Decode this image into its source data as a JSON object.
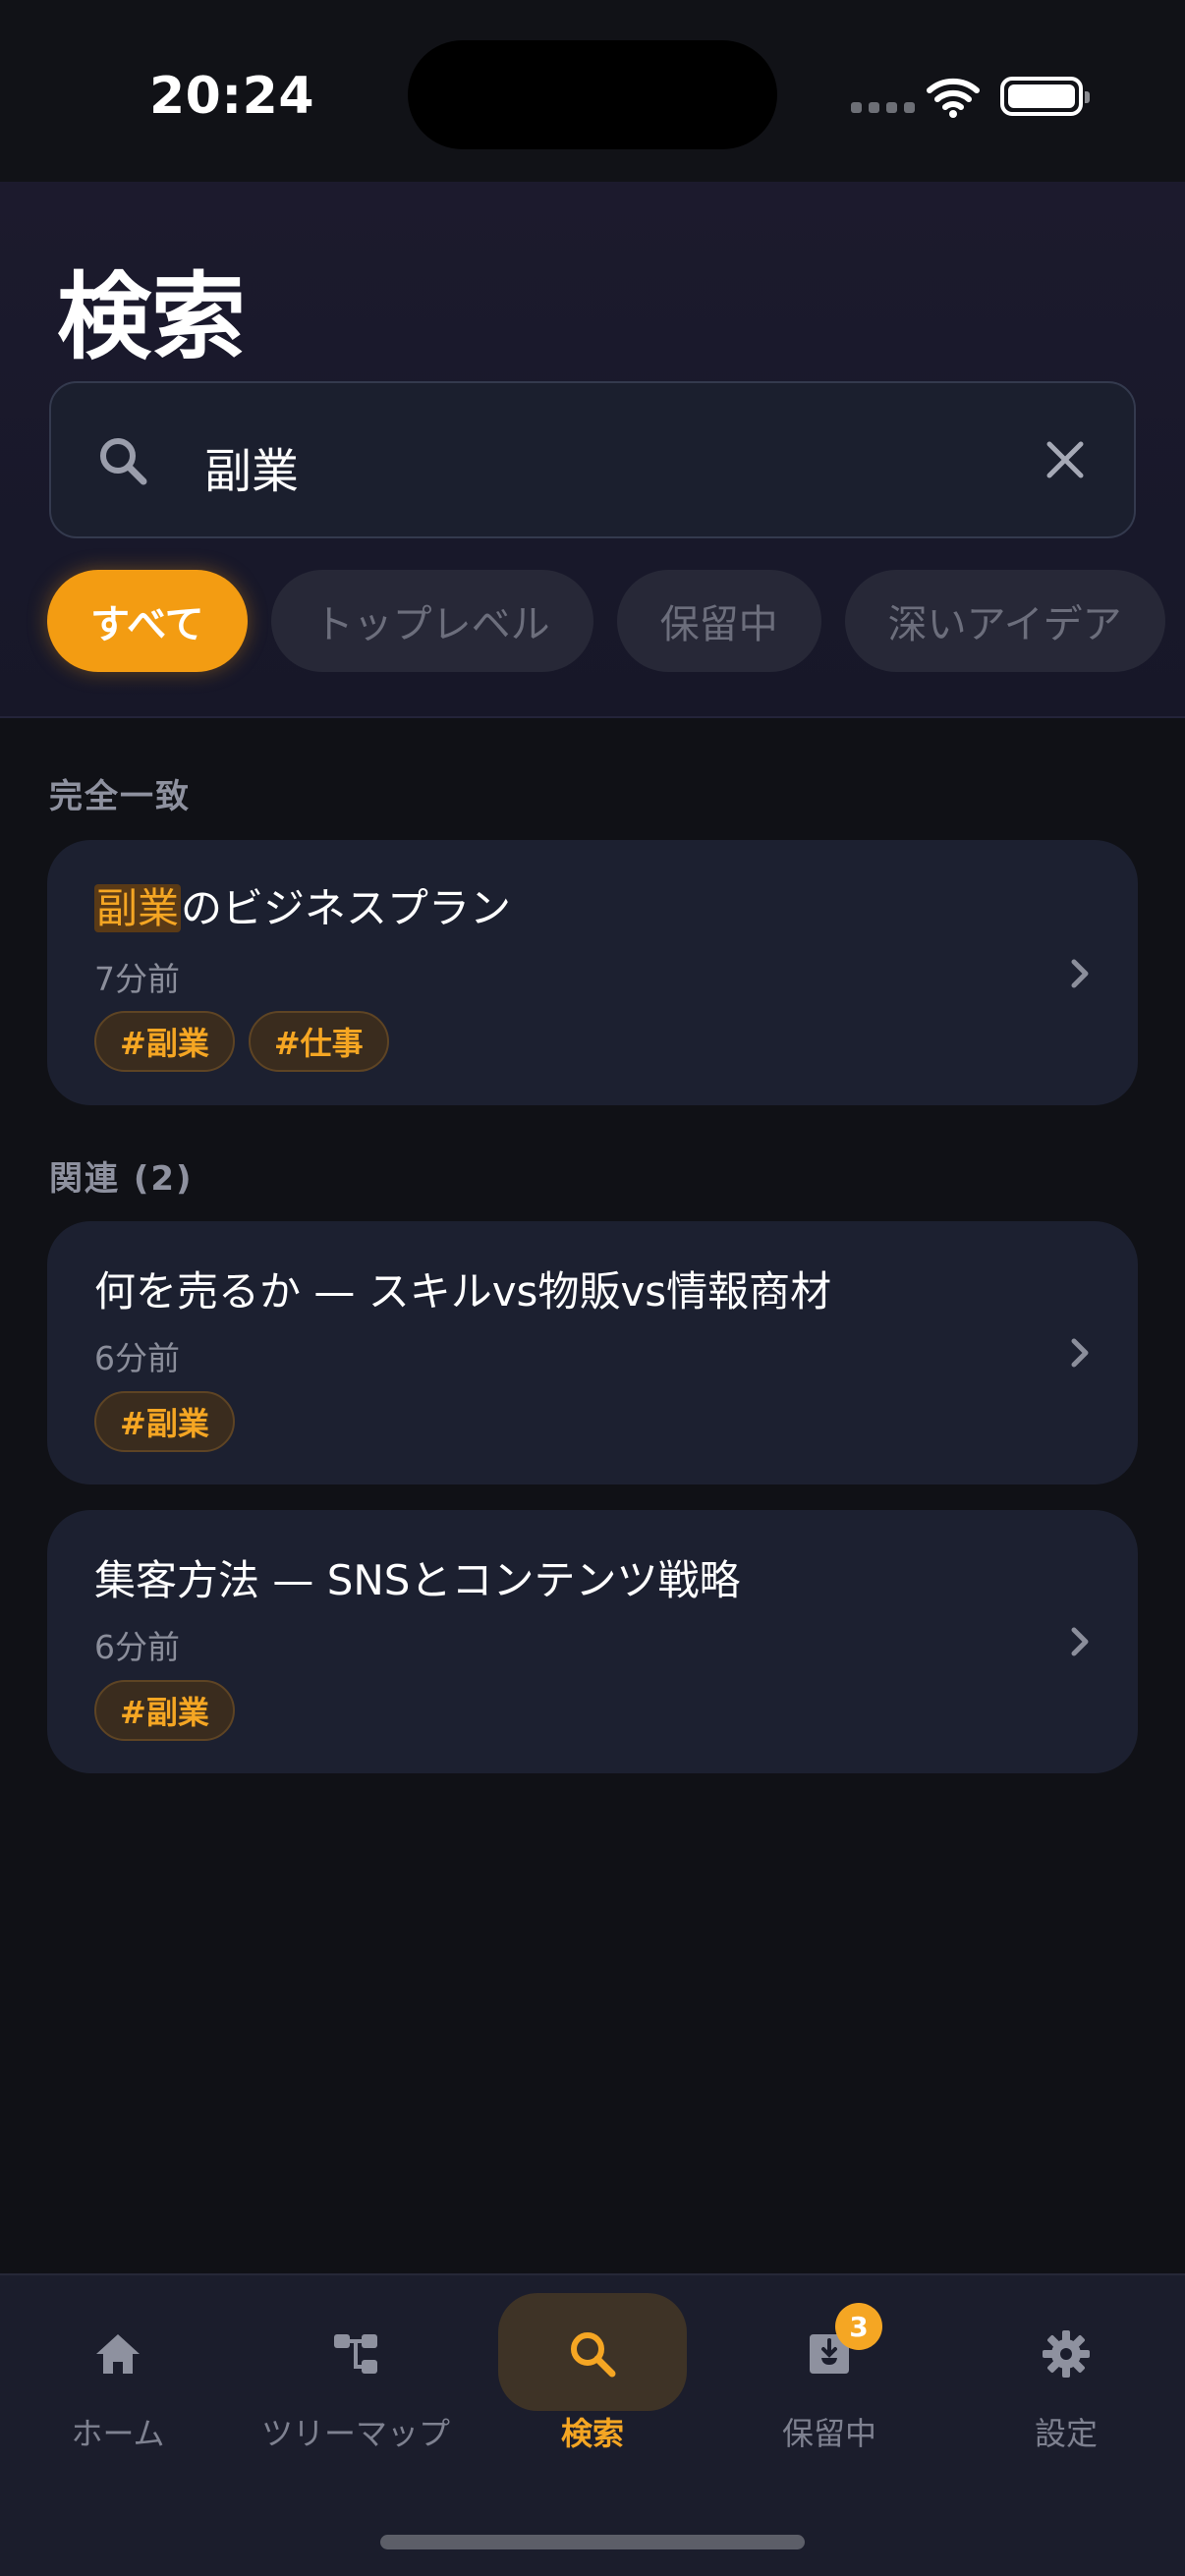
{
  "status": {
    "time": "20:24"
  },
  "header": {
    "title": "検索",
    "search": {
      "value": "副業"
    },
    "filters": [
      {
        "label": "すべて",
        "active": true
      },
      {
        "label": "トップレベル",
        "active": false
      },
      {
        "label": "保留中",
        "active": false
      },
      {
        "label": "深いアイデア",
        "active": false
      }
    ]
  },
  "sections": {
    "exact_label": "完全一致",
    "related_label": "関連 (2)"
  },
  "results": {
    "exact": [
      {
        "title_highlight": "副業",
        "title_rest": "のビジネスプラン",
        "time": "7分前",
        "tags": [
          "#副業",
          "#仕事"
        ]
      }
    ],
    "related": [
      {
        "title": "何を売るか — スキルvs物販vs情報商材",
        "time": "6分前",
        "tags": [
          "#副業"
        ]
      },
      {
        "title": "集客方法 — SNSとコンテンツ戦略",
        "time": "6分前",
        "tags": [
          "#副業"
        ]
      }
    ]
  },
  "tabbar": {
    "tabs": [
      {
        "label": "ホーム",
        "icon": "home-icon",
        "active": false
      },
      {
        "label": "ツリーマップ",
        "icon": "tree-map-icon",
        "active": false
      },
      {
        "label": "検索",
        "icon": "search-icon",
        "active": true
      },
      {
        "label": "保留中",
        "icon": "inbox-icon",
        "active": false
      },
      {
        "label": "設定",
        "icon": "gear-icon",
        "active": false
      }
    ],
    "pending_badge": "3"
  },
  "colors": {
    "accent": "#f5a623",
    "background": "#101116",
    "card": "#1c2030"
  }
}
